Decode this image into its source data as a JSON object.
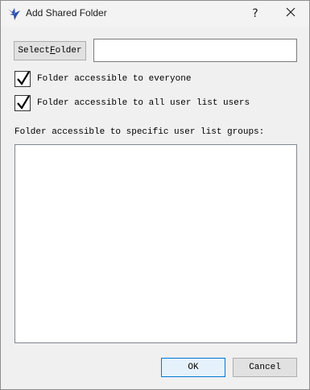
{
  "window": {
    "title": "Add Shared Folder",
    "help_label": "?",
    "icons": {
      "app": "bird-logo-icon",
      "close": "close-icon"
    }
  },
  "folder": {
    "select_button_label_prefix": "Select ",
    "select_button_label_mnemonic": "F",
    "select_button_label_suffix": "older",
    "path_value": ""
  },
  "options": [
    {
      "label": "Folder accessible to everyone",
      "checked": true
    },
    {
      "label": "Folder accessible to all user list users",
      "checked": true
    }
  ],
  "groups": {
    "label": "Folder accessible to specific user list groups:",
    "items": []
  },
  "buttons": {
    "ok_label": "OK",
    "cancel_label": "Cancel"
  },
  "colors": {
    "accent": "#0078d7",
    "window_bg": "#f0f0f0",
    "button_bg": "#e1e1e1",
    "app_icon": "#2b4fa8"
  }
}
